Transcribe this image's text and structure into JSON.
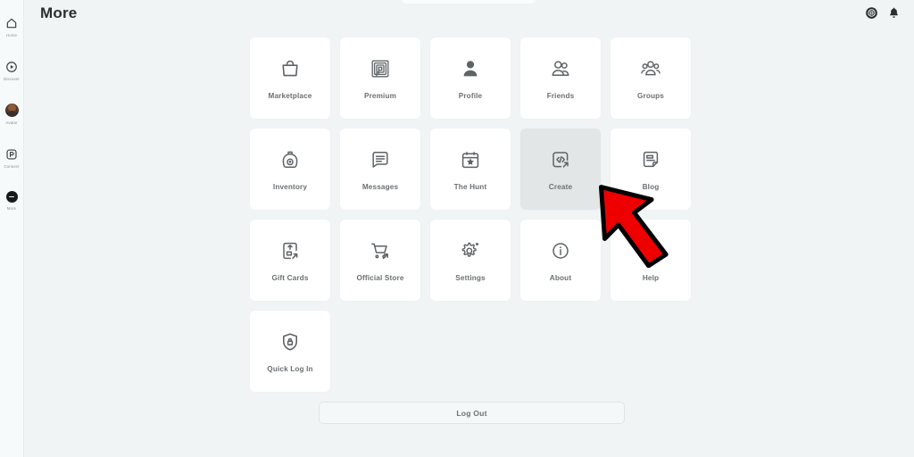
{
  "header": {
    "title": "More",
    "right_icons": [
      {
        "name": "robux-icon",
        "label": "Robux"
      },
      {
        "name": "bell-icon",
        "label": "Notifications"
      }
    ]
  },
  "sidebar": {
    "items": [
      {
        "label": "Home",
        "icon": "home-icon",
        "active": false
      },
      {
        "label": "Discover",
        "icon": "discover-icon",
        "active": false
      },
      {
        "label": "Avatar",
        "icon": "avatar-image",
        "active": false
      },
      {
        "label": "Connect",
        "icon": "connect-icon",
        "active": false
      },
      {
        "label": "More",
        "icon": "more-icon",
        "active": true
      }
    ]
  },
  "main": {
    "tiles": [
      {
        "label": "Marketplace",
        "icon": "shopping-bag-icon",
        "active": false
      },
      {
        "label": "Premium",
        "icon": "premium-icon",
        "active": false
      },
      {
        "label": "Profile",
        "icon": "person-icon",
        "active": false
      },
      {
        "label": "Friends",
        "icon": "friends-icon",
        "active": false
      },
      {
        "label": "Groups",
        "icon": "groups-icon",
        "active": false
      },
      {
        "label": "Inventory",
        "icon": "backpack-icon",
        "active": false
      },
      {
        "label": "Messages",
        "icon": "message-icon",
        "active": false
      },
      {
        "label": "The Hunt",
        "icon": "calendar-star-icon",
        "active": false
      },
      {
        "label": "Create",
        "icon": "code-icon",
        "active": true
      },
      {
        "label": "Blog",
        "icon": "blog-icon",
        "active": false
      },
      {
        "label": "Gift Cards",
        "icon": "gift-card-icon",
        "active": false
      },
      {
        "label": "Official Store",
        "icon": "cart-icon",
        "active": false
      },
      {
        "label": "Settings",
        "icon": "gear-icon",
        "active": false
      },
      {
        "label": "About",
        "icon": "info-icon",
        "active": false
      },
      {
        "label": "Help",
        "icon": "help-icon",
        "active": false
      },
      {
        "label": "Quick Log In",
        "icon": "shield-lock-icon",
        "active": false
      }
    ],
    "logout_label": "Log Out"
  },
  "colors": {
    "background": "#f0f4f5",
    "tile": "#ffffff",
    "tile_active": "#e3e6e7",
    "label": "#6b7073",
    "cursor_red": "#ee0000"
  }
}
